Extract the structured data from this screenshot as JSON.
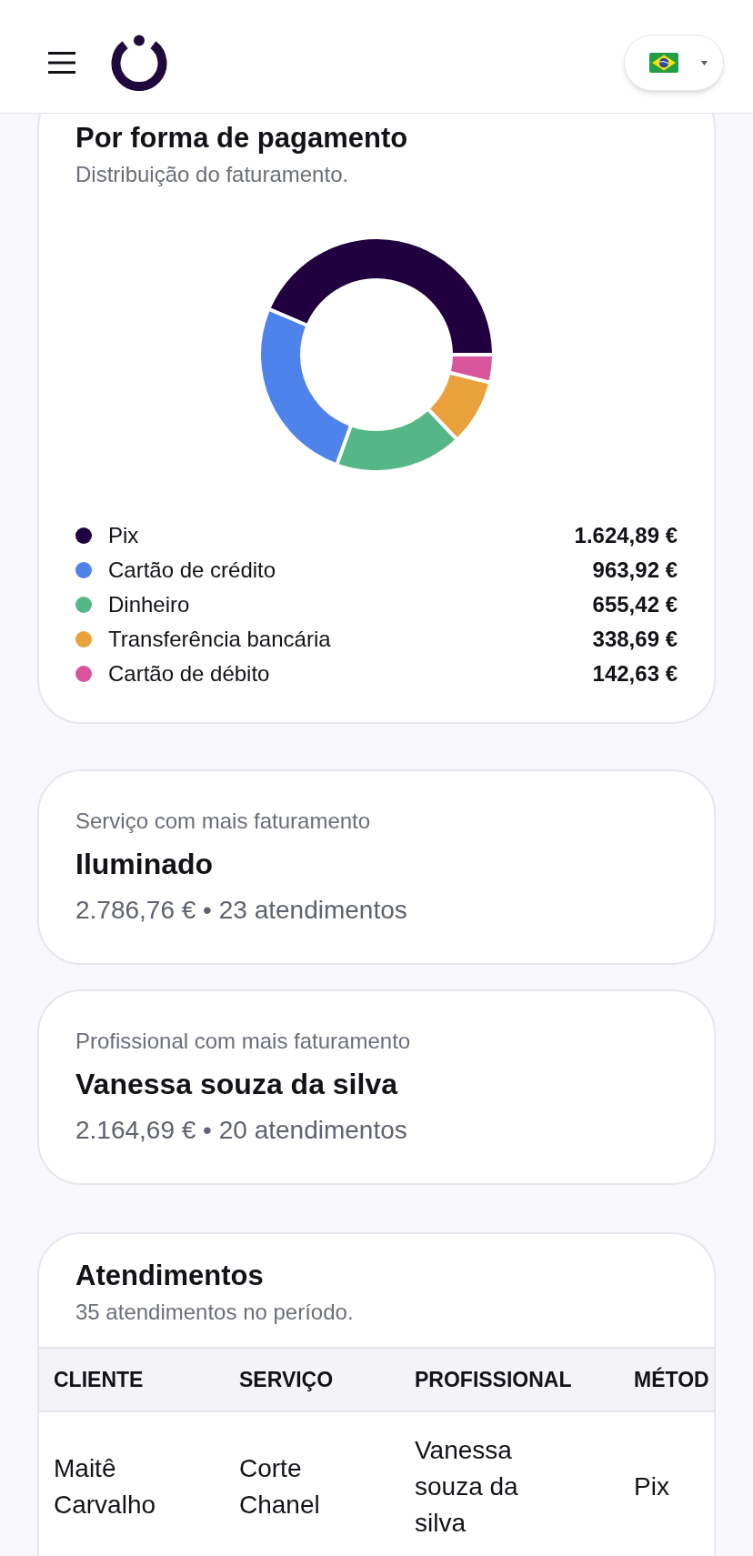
{
  "payment": {
    "title": "Por forma de pagamento",
    "subtitle": "Distribuição do faturamento.",
    "chart_data": {
      "type": "donut",
      "categories": [
        "Pix",
        "Cartão de crédito",
        "Dinheiro",
        "Transferência bancária",
        "Cartão de débito"
      ],
      "values": [
        43.62,
        25.87,
        17.59,
        9.09,
        3.83
      ]
    },
    "legend": [
      {
        "amount": "1.624,89 €",
        "color": "#20003f"
      },
      {
        "amount": "963,92 €",
        "color": "#4f83ec"
      },
      {
        "amount": "655,42 €",
        "color": "#55b788"
      },
      {
        "amount": "338,69 €",
        "color": "#e9a23b"
      },
      {
        "amount": "142,63 €",
        "color": "#d8559c"
      }
    ]
  },
  "highlights": [
    {
      "label": "Serviço com mais faturamento",
      "name": "Iluminado",
      "summary": "2.786,76 € • 23 atendimentos"
    },
    {
      "label": "Profissional com mais faturamento",
      "name": "Vanessa souza da silva",
      "summary": "2.164,69 € • 20 atendimentos"
    }
  ],
  "appointments": {
    "title": "Atendimentos",
    "subtitle": "35 atendimentos no período.",
    "table": {
      "columns": [
        "CLIENTE",
        "SERVIÇO",
        "PROFISSIONAL",
        "MÉTOD"
      ],
      "rows": [
        [
          "Maitê Carvalho",
          "Corte Chanel",
          "Vanessa souza da silva",
          "Pix"
        ]
      ]
    }
  }
}
